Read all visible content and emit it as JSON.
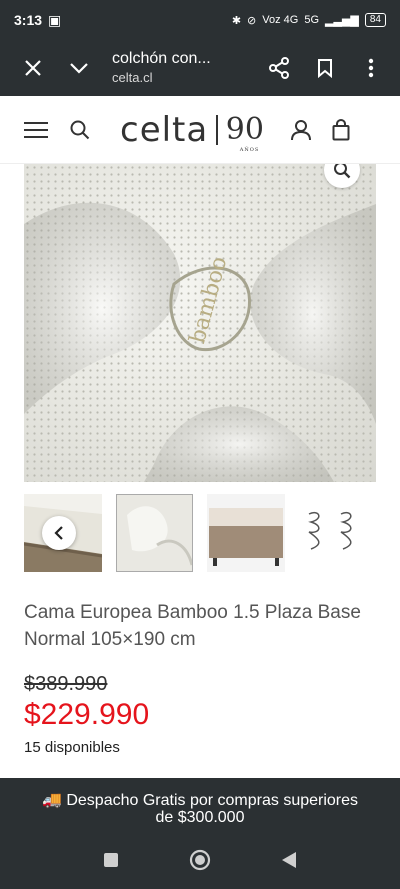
{
  "status_bar": {
    "time": "3:13",
    "network_label": "Voz 4G",
    "signal_label": "5G",
    "battery": "84"
  },
  "browser": {
    "tab_title": "colchón con...",
    "url": "celta.cl"
  },
  "site": {
    "logo_text": "celta",
    "logo_anniversary": "90",
    "logo_anniversary_sub": "AÑOS"
  },
  "product": {
    "title": "Cama Europea Bamboo 1.5 Plaza Base Normal 105×190 cm",
    "old_price": "$389.990",
    "price": "$229.990",
    "stock": "15 disponibles"
  },
  "banner": {
    "icon": "truck-icon",
    "line1": "🚚 Despacho Gratis por compras superiores",
    "line2": "de $300.000"
  },
  "colors": {
    "dark_bar": "#2b3033",
    "price_red": "#e5141c"
  }
}
